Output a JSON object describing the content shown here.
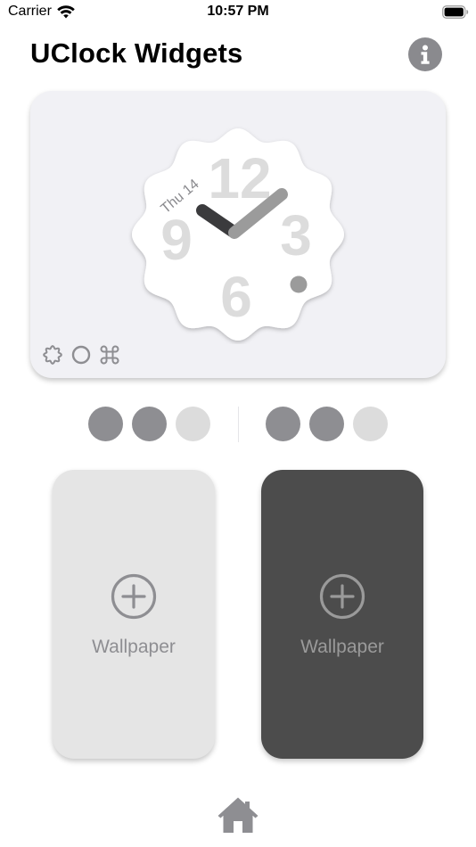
{
  "status_bar": {
    "carrier": "Carrier",
    "time": "10:57 PM",
    "icons": [
      "wifi-icon",
      "battery-icon"
    ]
  },
  "header": {
    "title": "UClock Widgets",
    "info_icon": "info-icon"
  },
  "clock_preview": {
    "date_label": "Thu 14",
    "numerals": [
      "12",
      "3",
      "6",
      "9"
    ],
    "time_shown": "10:08",
    "hand_colors": {
      "hour": "#3b3b3d",
      "minute": "#9b9b9b",
      "dot": "#9b9b9b"
    },
    "numeral_color": "#dcdcdc",
    "face_color": "#ffffff",
    "style_options": [
      "wavy-circle-icon",
      "circle-icon",
      "command-icon"
    ]
  },
  "color_dots": {
    "left": [
      "#8e8e92",
      "#8e8e92",
      "#dcdcdc"
    ],
    "right": [
      "#8e8e92",
      "#8e8e92",
      "#dcdcdc"
    ]
  },
  "wallpapers": [
    {
      "label": "Wallpaper",
      "theme": "light",
      "icon": "plus-circle-icon"
    },
    {
      "label": "Wallpaper",
      "theme": "dark",
      "icon": "plus-circle-icon"
    }
  ],
  "tab_bar": {
    "home_icon": "home-icon"
  },
  "colors": {
    "accent_gray": "#8a8a8e",
    "card_bg": "#f1f1f5",
    "light_wallpaper_bg": "#e5e5e5",
    "dark_wallpaper_bg": "#4c4c4c"
  }
}
